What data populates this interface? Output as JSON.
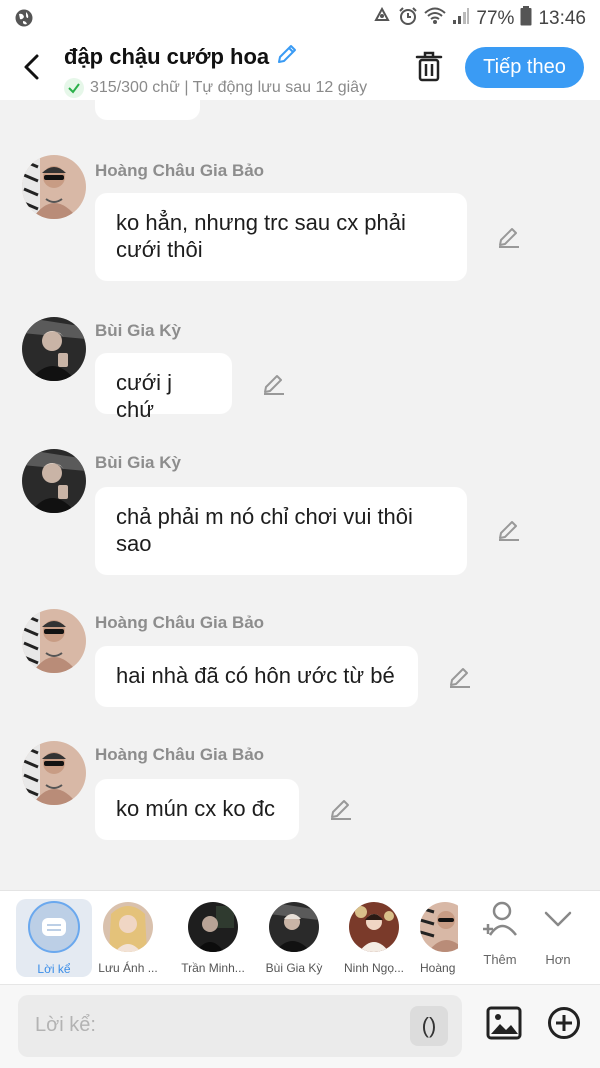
{
  "status_bar": {
    "battery": "77%",
    "time": "13:46"
  },
  "header": {
    "title": "đập chậu cướp hoa",
    "subtitle": "315/300 chữ | Tự động lưu sau 12 giây",
    "next_label": "Tiếp theo"
  },
  "messages": [
    {
      "sender": "Hoàng Châu Gia Bảo",
      "line1": "ko hẳn, nhưng trc sau cx phải",
      "line2": "cưới thôi"
    },
    {
      "sender": "Bùi Gia Kỳ",
      "line1": "cưới j chứ"
    },
    {
      "sender": "Bùi Gia Kỳ",
      "line1": "chả phải m nó chỉ chơi vui thôi",
      "line2": "sao"
    },
    {
      "sender": "Hoàng Châu Gia Bảo",
      "line1": "hai nhà đã có hôn ước từ bé"
    },
    {
      "sender": "Hoàng Châu Gia Bảo",
      "line1": "ko mún cx ko đc"
    }
  ],
  "characters": [
    {
      "name": "Lời kể"
    },
    {
      "name": "Lưu Ánh ..."
    },
    {
      "name": "Trần Minh..."
    },
    {
      "name": "Bùi Gia Kỳ"
    },
    {
      "name": "Ninh Ngọ..."
    },
    {
      "name": "Hoàng"
    }
  ],
  "strip_actions": {
    "add_label": "Thêm",
    "more_label": "Hơn"
  },
  "input": {
    "placeholder": "Lời kể:",
    "paren_label": "()"
  },
  "colors": {
    "accent": "#3a9bf4",
    "background": "#f2f2f2",
    "bubble": "#ffffff"
  },
  "icons": [
    "globe-icon",
    "recycle-icon",
    "alarm-icon",
    "wifi-icon",
    "signal-icon",
    "battery-icon",
    "back-arrow-icon",
    "pencil-icon",
    "check-icon",
    "trash-icon",
    "narrator-icon",
    "add-person-icon",
    "chevron-down-icon",
    "image-icon",
    "plus-circle-icon"
  ]
}
